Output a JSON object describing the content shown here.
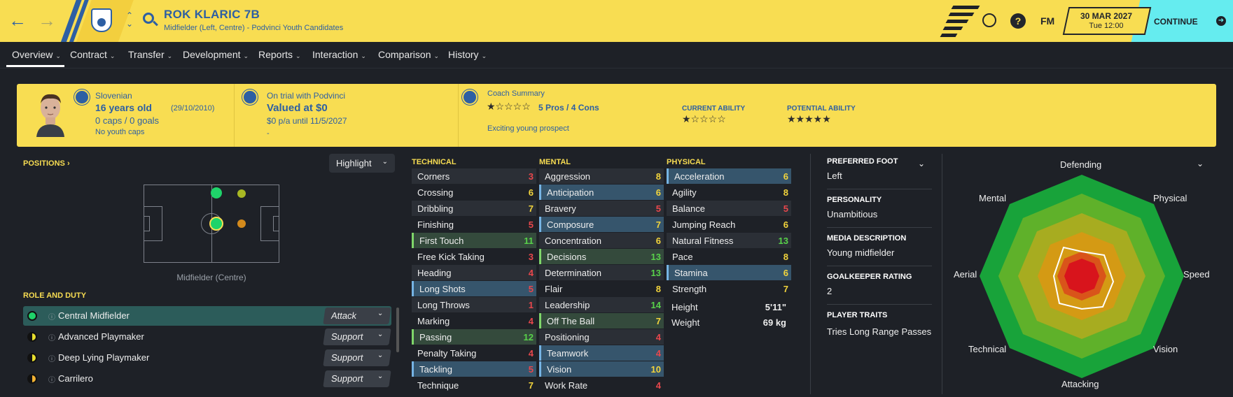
{
  "header": {
    "player_name": "ROK KLARIC 7B",
    "player_subtitle": "Midfielder (Left, Centre) - Podvinci Youth Candidates",
    "fm_label": "FM",
    "help_label": "?",
    "date": "30 MAR 2027",
    "time": "Tue 12:00",
    "continue_label": "CONTINUE"
  },
  "tabs": [
    {
      "label": "Overview"
    },
    {
      "label": "Contract"
    },
    {
      "label": "Transfer"
    },
    {
      "label": "Development"
    },
    {
      "label": "Reports"
    },
    {
      "label": "Interaction"
    },
    {
      "label": "Comparison"
    },
    {
      "label": "History"
    }
  ],
  "info": {
    "nationality": "Slovenian",
    "age": "16 years old",
    "dob": "(29/10/2010)",
    "caps": "0 caps / 0 goals",
    "youth_caps": "No youth caps",
    "trial": "On trial with Podvinci",
    "value": "Valued at $0",
    "wage": "$0 p/a until 11/5/2027",
    "dash": "-",
    "coach_title": "Coach Summary",
    "coach_proscons": "5 Pros / 4 Cons",
    "coach_comment": "Exciting young prospect",
    "coach_stars": 1.5,
    "current_ability_label": "CURRENT ABILITY",
    "current_ability_stars": 1.5,
    "potential_ability_label": "POTENTIAL ABILITY",
    "potential_ability_stars": 5
  },
  "positions": {
    "title": "POSITIONS",
    "highlight_label": "Highlight",
    "position_label": "Midfielder (Centre)",
    "role_title": "ROLE AND DUTY",
    "roles": [
      {
        "name": "Central Midfielder",
        "duty": "Attack",
        "color": "#1fd36a"
      },
      {
        "name": "Advanced Playmaker",
        "duty": "Support",
        "color": "#e8df2e"
      },
      {
        "name": "Deep Lying Playmaker",
        "duty": "Support",
        "color": "#e8df2e"
      },
      {
        "name": "Carrilero",
        "duty": "Support",
        "color": "#f2b233"
      }
    ]
  },
  "attributes": {
    "technical_title": "TECHNICAL",
    "mental_title": "MENTAL",
    "physical_title": "PHYSICAL",
    "technical": [
      {
        "name": "Corners",
        "value": "3"
      },
      {
        "name": "Crossing",
        "value": "6"
      },
      {
        "name": "Dribbling",
        "value": "7"
      },
      {
        "name": "Finishing",
        "value": "5"
      },
      {
        "name": "First Touch",
        "value": "11"
      },
      {
        "name": "Free Kick Taking",
        "value": "3"
      },
      {
        "name": "Heading",
        "value": "4"
      },
      {
        "name": "Long Shots",
        "value": "5"
      },
      {
        "name": "Long Throws",
        "value": "1"
      },
      {
        "name": "Marking",
        "value": "4"
      },
      {
        "name": "Passing",
        "value": "12"
      },
      {
        "name": "Penalty Taking",
        "value": "4"
      },
      {
        "name": "Tackling",
        "value": "5"
      },
      {
        "name": "Technique",
        "value": "7"
      }
    ],
    "mental": [
      {
        "name": "Aggression",
        "value": "8"
      },
      {
        "name": "Anticipation",
        "value": "6"
      },
      {
        "name": "Bravery",
        "value": "5"
      },
      {
        "name": "Composure",
        "value": "7"
      },
      {
        "name": "Concentration",
        "value": "6"
      },
      {
        "name": "Decisions",
        "value": "13"
      },
      {
        "name": "Determination",
        "value": "13"
      },
      {
        "name": "Flair",
        "value": "8"
      },
      {
        "name": "Leadership",
        "value": "14"
      },
      {
        "name": "Off The Ball",
        "value": "7"
      },
      {
        "name": "Positioning",
        "value": "4"
      },
      {
        "name": "Teamwork",
        "value": "4"
      },
      {
        "name": "Vision",
        "value": "10"
      },
      {
        "name": "Work Rate",
        "value": "4"
      }
    ],
    "physical": [
      {
        "name": "Acceleration",
        "value": "6"
      },
      {
        "name": "Agility",
        "value": "8"
      },
      {
        "name": "Balance",
        "value": "5"
      },
      {
        "name": "Jumping Reach",
        "value": "6"
      },
      {
        "name": "Natural Fitness",
        "value": "13"
      },
      {
        "name": "Pace",
        "value": "8"
      },
      {
        "name": "Stamina",
        "value": "6"
      },
      {
        "name": "Strength",
        "value": "7"
      }
    ],
    "height_label": "Height",
    "height_value": "5'11\"",
    "weight_label": "Weight",
    "weight_value": "69 kg"
  },
  "profile": {
    "preferred_foot_label": "PREFERRED FOOT",
    "preferred_foot": "Left",
    "personality_label": "PERSONALITY",
    "personality": "Unambitious",
    "media_label": "MEDIA DESCRIPTION",
    "media": "Young midfielder",
    "gk_label": "GOALKEEPER RATING",
    "gk": "2",
    "traits_label": "PLAYER TRAITS",
    "traits": "Tries Long Range Passes"
  },
  "radar": {
    "labels": [
      "Defending",
      "Physical",
      "Speed",
      "Vision",
      "Attacking",
      "Technical",
      "Aerial",
      "Mental"
    ]
  },
  "colors": {
    "accent": "#f8dd52",
    "brand_blue": "#2d5fa3",
    "continue": "#65ecef",
    "red": "#e8474c",
    "yellow": "#f2d43c",
    "green": "#58d14a"
  }
}
